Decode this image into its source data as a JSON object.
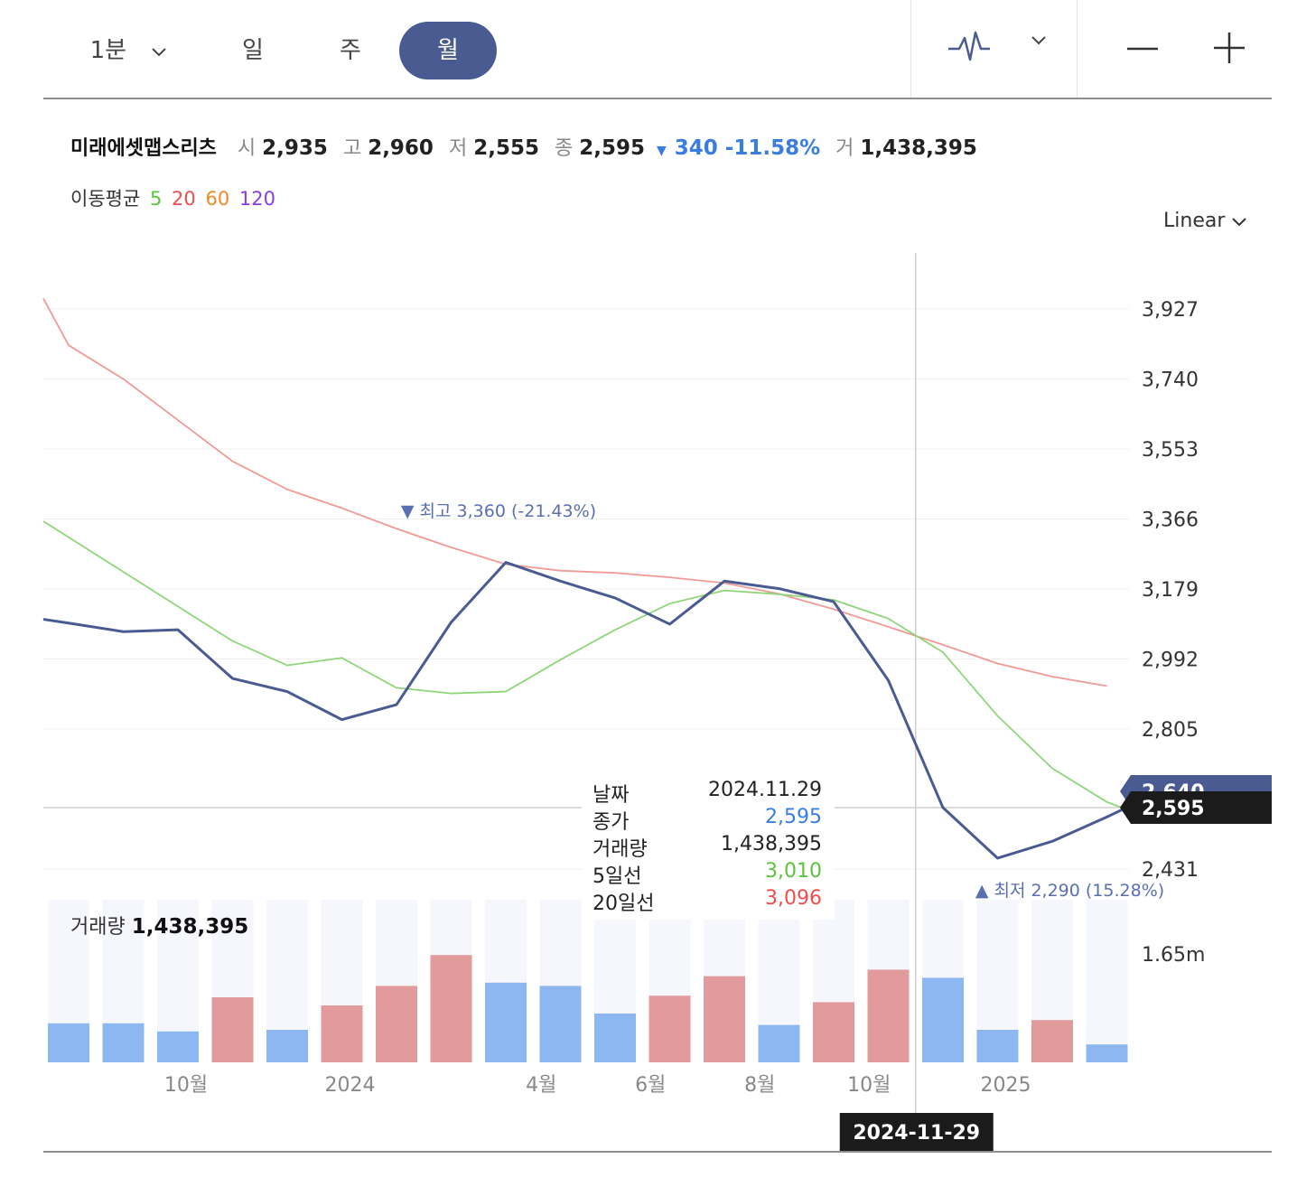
{
  "toolbar": {
    "period_label": "1분",
    "day_label": "일",
    "week_label": "주",
    "month_label": "월",
    "chart_type_icon": "line-chart-icon",
    "zoom_out_icon": "minus-icon",
    "zoom_in_icon": "plus-icon"
  },
  "quote": {
    "name": "미래에셋맵스리츠",
    "open_key": "시",
    "open": "2,935",
    "high_key": "고",
    "high": "2,960",
    "low_key": "저",
    "low": "2,555",
    "close_key": "종",
    "close": "2,595",
    "change_arrow": "▼",
    "change": "340 -11.58%",
    "volume_key": "거",
    "volume": "1,438,395"
  },
  "ma_legend": {
    "label": "이동평균",
    "p5": "5",
    "p20": "20",
    "p60": "60",
    "p120": "120",
    "colors": {
      "p5": "#5cc43c",
      "p20": "#ee4e4e",
      "p60": "#f08a24",
      "p120": "#8a3ce8"
    }
  },
  "scale_mode": "Linear",
  "colors": {
    "price_line": "#4a5b92",
    "ma5": "#8fd67a",
    "ma20": "#f29a95",
    "vol_up": "#e29b9c",
    "vol_down": "#8db7f0",
    "vol_bg": "#f5f7fc",
    "tooltip_blue": "#3a7de0",
    "tooltip_green": "#5cc43c",
    "tooltip_red": "#ee4e4e"
  },
  "tooltip": {
    "date_key": "날짜",
    "date": "2024.11.29",
    "close_key": "종가",
    "close": "2,595",
    "volume_key": "거래량",
    "volume": "1,438,395",
    "ma5_key": "5일선",
    "ma5": "3,010",
    "ma20_key": "20일선",
    "ma20": "3,096"
  },
  "volume_panel": {
    "label": "거래량",
    "value": "1,438,395",
    "axis_label": "1.65m"
  },
  "chart_data": {
    "type": "line",
    "x_labels": [
      {
        "index": 2,
        "label": "10월"
      },
      {
        "index": 5,
        "label": "2024"
      },
      {
        "index": 8.5,
        "label": "4월"
      },
      {
        "index": 10.5,
        "label": "6월"
      },
      {
        "index": 12.5,
        "label": "8월"
      },
      {
        "index": 14.5,
        "label": "10월"
      },
      {
        "index": 17,
        "label": "2025"
      }
    ],
    "y_ticks": [
      3927,
      3740,
      3553,
      3366,
      3179,
      2992,
      2805,
      2431
    ],
    "y_tick_labels": [
      "3,927",
      "3,740",
      "3,553",
      "3,366",
      "3,179",
      "2,992",
      "2,805",
      "2,431"
    ],
    "ylim": [
      2431,
      3927
    ],
    "price": [
      3088,
      3065,
      3070,
      2940,
      2905,
      2830,
      2870,
      3090,
      3250,
      3200,
      3155,
      3085,
      3200,
      3180,
      3145,
      2935,
      2595,
      2460,
      2505,
      2570,
      2640
    ],
    "price_start": 3098,
    "ma5": [
      3040,
      2975,
      2995,
      2915,
      2900,
      2905,
      2990,
      3070,
      3140,
      3175,
      3165,
      3150,
      3100,
      3010,
      2840,
      2700,
      2610,
      2555
    ],
    "ma5_start": 3360,
    "ma5_start_index": -1,
    "ma20": [
      3830,
      3740,
      3630,
      3520,
      3445,
      3395,
      3340,
      3290,
      3245,
      3228,
      3222,
      3210,
      3195,
      3166,
      3125,
      3078,
      3030,
      2980,
      2945,
      2920
    ],
    "ma20_start": 3955,
    "volume_rel": [
      0.24,
      0.24,
      0.19,
      0.4,
      0.2,
      0.35,
      0.47,
      0.66,
      0.49,
      0.47,
      0.3,
      0.41,
      0.53,
      0.23,
      0.37,
      0.57,
      0.52,
      0.2,
      0.26,
      0.11
    ],
    "volume_up": [
      false,
      false,
      false,
      true,
      false,
      true,
      true,
      true,
      false,
      false,
      false,
      true,
      true,
      false,
      true,
      true,
      false,
      false,
      true,
      false
    ],
    "high_marker": {
      "index": 8,
      "arrow": "▼",
      "label": "최고",
      "value": "3,360 (-21.43%)"
    },
    "low_marker": {
      "index": 17,
      "arrow": "▲",
      "label": "최저",
      "value": "2,290 (15.28%)"
    },
    "crosshair": {
      "index": 15.5,
      "date": "2024-11-29"
    },
    "last_price_tag": "2,640",
    "crosshair_price_tag": "2,595",
    "crosshair_price": 2595
  }
}
